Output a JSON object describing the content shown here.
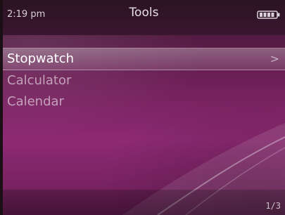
{
  "status": {
    "time": "2:19 pm",
    "title": "Tools",
    "battery_icon": "battery-icon"
  },
  "menu": {
    "items": [
      {
        "label": "Stopwatch",
        "selected": true
      },
      {
        "label": "Calculator",
        "selected": false
      },
      {
        "label": "Calendar",
        "selected": false
      }
    ],
    "chevron": ">"
  },
  "footer": {
    "page": "1/3"
  },
  "colors": {
    "bg_top": "#3a1630",
    "bg_mid": "#8e2a74",
    "text": "#ffffff"
  }
}
